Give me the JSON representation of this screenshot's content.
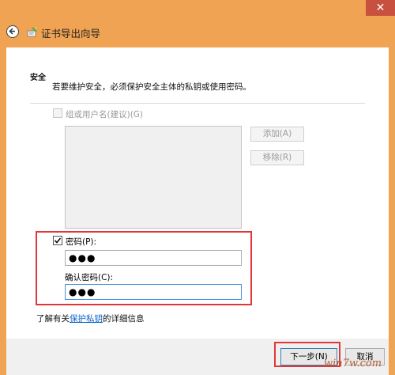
{
  "window": {
    "title": "证书导出向导",
    "close_glyph": "✕"
  },
  "section": {
    "title": "安全",
    "description": "若要维护安全，必须保护安全主体的私钥或使用密码。"
  },
  "group_option": {
    "label": "组或用户名(建议)(G)",
    "checked": false,
    "enabled": false
  },
  "buttons": {
    "add": "添加(A)",
    "remove": "移除(R)",
    "next": "下一步(N)",
    "cancel": "取消"
  },
  "password": {
    "checkbox_label": "密码(P):",
    "checked": true,
    "value": "●●●",
    "confirm_label": "确认密码(C):",
    "confirm_value": "●●●"
  },
  "info": {
    "prefix": "了解有关",
    "link": "保护私钥",
    "suffix": "的详细信息"
  },
  "watermark": "win7w.com",
  "colors": {
    "window_frame": "#f0a352",
    "highlight": "#e0383a",
    "link": "#0b63c6"
  }
}
